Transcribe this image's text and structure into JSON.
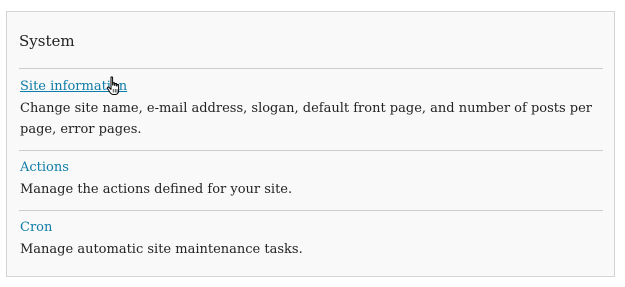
{
  "panel": {
    "title": "System",
    "items": [
      {
        "label": "Site information",
        "description": "Change site name, e-mail address, slogan, default front page, and number of posts per page, error pages."
      },
      {
        "label": "Actions",
        "description": "Manage the actions defined for your site."
      },
      {
        "label": "Cron",
        "description": "Manage automatic site maintenance tasks."
      }
    ]
  },
  "colors": {
    "link": "#0d7ca8",
    "text": "#222222",
    "divider": "#cccccc",
    "panel_bg": "#f9f9f9"
  },
  "icons": {
    "cursor": "hand-pointer-icon"
  }
}
